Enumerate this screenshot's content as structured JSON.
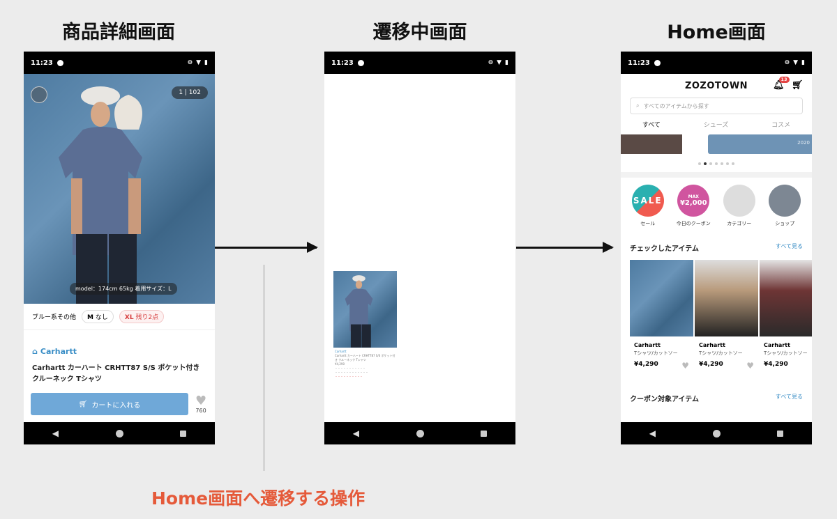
{
  "headings": {
    "detail": "商品詳細画面",
    "transition": "遷移中画面",
    "home": "Home画面"
  },
  "caption": "Home画面へ遷移する操作",
  "status": {
    "time": "11:23"
  },
  "detail": {
    "page_indicator": "1 | 102",
    "model_caption": "model：174cm 65kg 着用サイズ：L",
    "color": "ブルー系その他",
    "size_m": "M",
    "size_m_stock": "なし",
    "size_xl": "XL",
    "size_xl_stock": "残り2点",
    "brand": "Carhartt",
    "title": "Carhartt カーハート CRHTT87 S/S ポケット付き クルーネック Tシャツ",
    "cart_button": "カートに入れる",
    "fav_count": "760"
  },
  "transition": {
    "brand": "Carhartt",
    "title": "Carhartt カーハート CRHTT87 S/S ポケット付き クルーネック Tシャツ",
    "price": "¥4,290",
    "lines": [
      "・・・・・・・・・・・",
      "・・・・・・・・・・・・",
      "・・・・・・・・・・"
    ]
  },
  "home": {
    "logo": "ZOZOTOWN",
    "bell_badge": "13",
    "search_placeholder": "すべてのアイテムから探す",
    "tabs": [
      "すべて",
      "シューズ",
      "コスメ"
    ],
    "banner_text": "2020",
    "circles": [
      {
        "label": "セール",
        "inner": "SALE"
      },
      {
        "label": "今日のクーポン",
        "inner": "¥2,000",
        "sub": "MAX"
      },
      {
        "label": "カテゴリー",
        "inner": ""
      },
      {
        "label": "ショップ",
        "inner": ""
      }
    ],
    "checked_title": "チェックしたアイテム",
    "see_all": "すべて見る",
    "cards": [
      {
        "brand": "Carhartt",
        "category": "Tシャツ/カットソー",
        "price": "¥4,290"
      },
      {
        "brand": "Carhartt",
        "category": "Tシャツ/カットソー",
        "price": "¥4,290"
      },
      {
        "brand": "Carhartt",
        "category": "Tシャツ/カットソー",
        "price": "¥4,290"
      }
    ],
    "coupon_title": "クーポン対象アイテム",
    "coupon_see_all": "すべて見る"
  }
}
